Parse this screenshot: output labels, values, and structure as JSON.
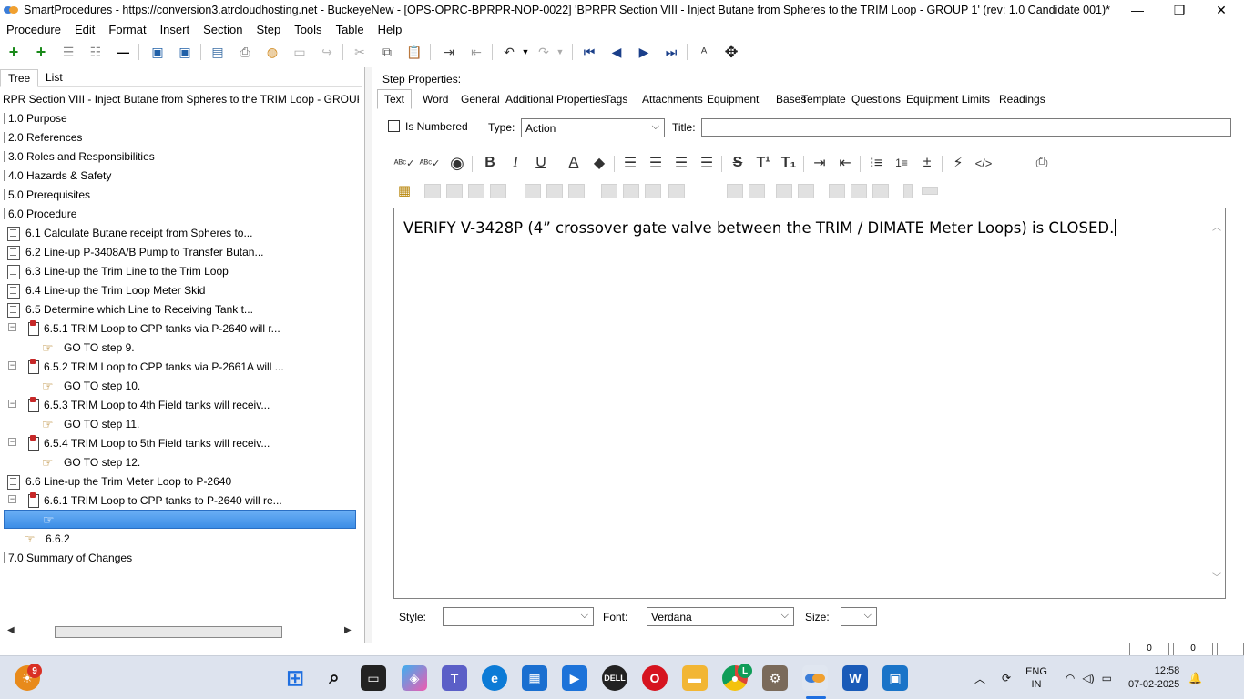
{
  "window": {
    "title": "SmartProcedures - https://conversion3.atrcloudhosting.net - BuckeyeNew - [OPS-OPRC-BPRPR-NOP-0022] 'BPRPR Section VIII - Inject Butane from Spheres to the TRIM Loop - GROUP 1' (rev: 1.0 Candidate 001)*"
  },
  "menu": [
    "Procedure",
    "Edit",
    "Format",
    "Insert",
    "Section",
    "Step",
    "Tools",
    "Table",
    "Help"
  ],
  "left_tabs": [
    "Tree",
    "List"
  ],
  "tree": {
    "root": "RPR Section VIII - Inject Butane from Spheres to the TRIM Loop - GROUP...",
    "items": [
      {
        "label": "1.0 Purpose"
      },
      {
        "label": "2.0 References"
      },
      {
        "label": "3.0 Roles and Responsibilities"
      },
      {
        "label": "4.0 Hazards & Safety"
      },
      {
        "label": "5.0 Prerequisites"
      },
      {
        "label": "6.0 Procedure"
      },
      {
        "label": "6.1 Calculate Butane receipt from Spheres to..."
      },
      {
        "label": "6.2 Line-up P-3408A/B Pump to Transfer Butan..."
      },
      {
        "label": "6.3 Line-up the Trim Line to the Trim Loop"
      },
      {
        "label": "6.4 Line-up the Trim Loop Meter Skid"
      },
      {
        "label": "6.5 Determine which Line to Receiving Tank t..."
      },
      {
        "label": "6.5.1 TRIM Loop to CPP tanks via P-2640 will r..."
      },
      {
        "label": "GO TO step 9."
      },
      {
        "label": "6.5.2 TRIM Loop to CPP tanks via P-2661A will ..."
      },
      {
        "label": "GO TO step 10."
      },
      {
        "label": "6.5.3 TRIM Loop to 4th Field tanks will receiv..."
      },
      {
        "label": "GO TO step 11."
      },
      {
        "label": "6.5.4 TRIM Loop to 5th Field tanks will receiv..."
      },
      {
        "label": "GO TO step 12."
      },
      {
        "label": "6.6 Line-up the Trim Meter Loop to P-2640"
      },
      {
        "label": "6.6.1 TRIM Loop to CPP tanks to P-2640 will re..."
      },
      {
        "label": ""
      },
      {
        "label": "6.6.2"
      },
      {
        "label": "7.0 Summary of Changes"
      }
    ]
  },
  "step_props": {
    "label": "Step Properties:",
    "tabs": [
      "Text",
      "Word",
      "General",
      "Additional Properties",
      "Tags",
      "Attachments",
      "Equipment",
      "Bases",
      "Template",
      "Questions",
      "Equipment Limits",
      "Readings"
    ],
    "is_numbered_label": "Is Numbered",
    "type_label": "Type:",
    "type_value": "Action",
    "title_label": "Title:",
    "title_value": "",
    "editor_text": "VERIFY V-3428P (4” crossover gate valve between the TRIM / DIMATE Meter Loops) is CLOSED.",
    "style_label": "Style:",
    "style_value": "",
    "font_label": "Font:",
    "font_value": "Verdana",
    "size_label": "Size:",
    "size_value": ""
  },
  "status": {
    "box1": "0",
    "box2": "0"
  },
  "taskbar": {
    "weather_badge": "9",
    "chrome_badge": "L",
    "lang": "ENG",
    "region": "IN",
    "time": "12:58",
    "date": "07-02-2025"
  }
}
